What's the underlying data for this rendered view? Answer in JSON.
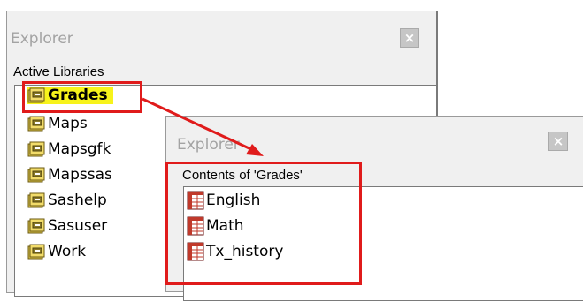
{
  "explorer_main": {
    "title": "Explorer",
    "close_glyph": "×",
    "panel_header": "Active Libraries",
    "libraries": [
      {
        "label": "Grades",
        "highlighted": true
      },
      {
        "label": "Maps"
      },
      {
        "label": "Mapsgfk"
      },
      {
        "label": "Mapssas"
      },
      {
        "label": "Sashelp"
      },
      {
        "label": "Sasuser"
      },
      {
        "label": "Work"
      }
    ]
  },
  "explorer_contents": {
    "title": "Explorer",
    "close_glyph": "×",
    "panel_header": "Contents of 'Grades'",
    "tables": [
      {
        "label": "English"
      },
      {
        "label": "Math"
      },
      {
        "label": "Tx_history"
      }
    ]
  },
  "colors": {
    "highlight": "#f7f31b",
    "annotation": "#e01b1b",
    "library_icon": "#d9c24a",
    "table_icon": "#c0392b"
  },
  "icons": {
    "library": "library-drawer-icon",
    "table": "sas-table-icon",
    "close": "close-icon"
  }
}
